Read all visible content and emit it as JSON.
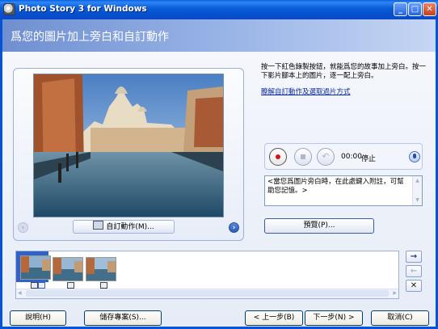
{
  "window": {
    "title": "Photo Story 3 for Windows",
    "minimize_glyph": "_",
    "maximize_glyph": "□",
    "close_glyph": "✕"
  },
  "header": {
    "title": "爲您的圖片加上旁白和自訂動作"
  },
  "preview": {
    "customize_label": "自訂動作(M)...",
    "prev_glyph": "‹",
    "next_glyph": "›"
  },
  "instructions": {
    "text": "按一下紅色錄製按鈕，就能爲您的故事加上旁白。按一下影片腳本上的圖片，逐一配上旁白。",
    "link": "瞭解自訂動作及選取過片方式"
  },
  "recorder": {
    "time": "00:00",
    "status": "停止",
    "undo_glyph": "↶"
  },
  "notes": {
    "text": "<當您爲圖片旁白時，在此處鍵入附註，可幫助您記憶。>"
  },
  "preview_button": "預覽(P)...",
  "filmstrip": {
    "thumbnails": 3,
    "selected_index": 0,
    "move_right": "→",
    "move_left": "←",
    "remove": "✕",
    "scroll_left_glyph": "◀",
    "scroll_right_glyph": "▶"
  },
  "footer": {
    "help": "說明(H)",
    "save_project": "儲存專案(S)...",
    "back": "< 上一步(B)",
    "next": "下一步(N) >",
    "cancel": "取消(C)"
  },
  "colors": {
    "title_bar": "#0553d6",
    "record": "#d11414",
    "accent": "#3163c6"
  }
}
